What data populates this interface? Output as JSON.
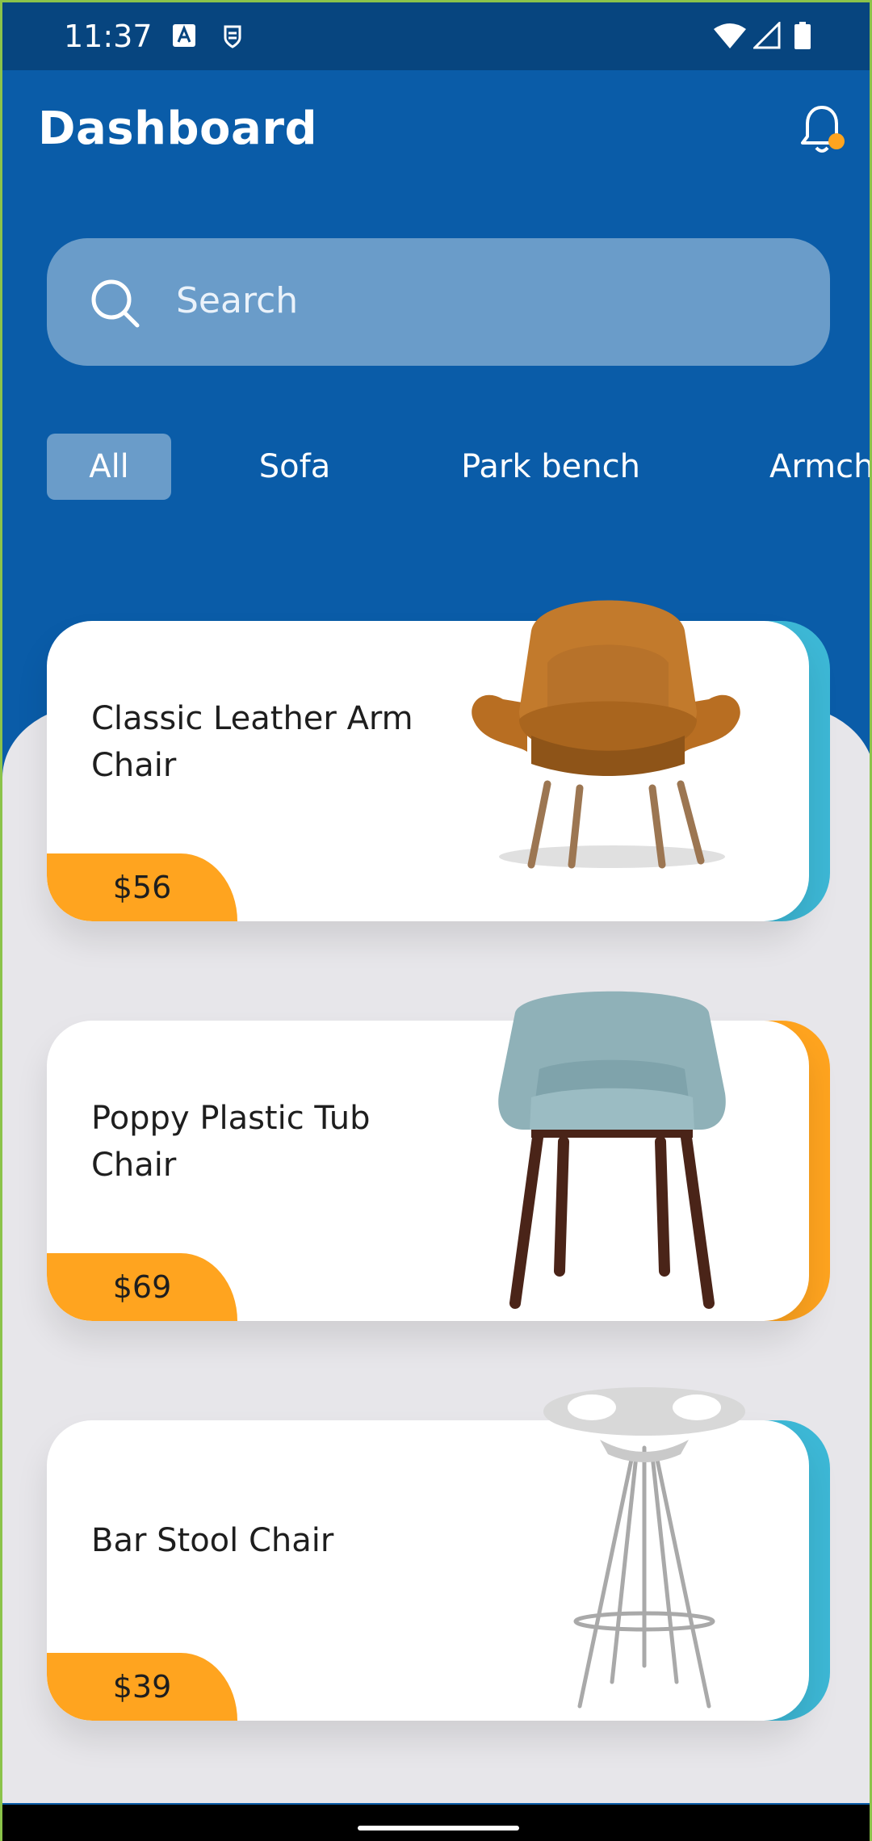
{
  "status_bar": {
    "time": "11:37",
    "icons": [
      "a-box-icon",
      "sync-shield-icon",
      "wifi-icon",
      "cellular-icon",
      "battery-icon"
    ]
  },
  "header": {
    "title": "Dashboard",
    "notification_icon": "bell-icon",
    "notification_dot_color": "#FFA41F"
  },
  "search": {
    "placeholder": "Search",
    "icon": "search-icon"
  },
  "categories": [
    {
      "label": "All",
      "active": true
    },
    {
      "label": "Sofa",
      "active": false
    },
    {
      "label": "Park bench",
      "active": false
    },
    {
      "label": "Armch",
      "active": false
    }
  ],
  "products": [
    {
      "name": "Classic Leather Arm Chair",
      "price": "$56",
      "accent_color": "#3DB8D6",
      "image": "armchair-image"
    },
    {
      "name": "Poppy Plastic Tub Chair",
      "price": "$69",
      "accent_color": "#FFA41F",
      "image": "tub-chair-image"
    },
    {
      "name": "Bar Stool Chair",
      "price": "$39",
      "accent_color": "#3DB8D6",
      "image": "bar-stool-image"
    }
  ],
  "colors": {
    "primary": "#0A5CA8",
    "status_bar": "#07457F",
    "chip_active": "#6A9CC9",
    "price_tab": "#FFA41F",
    "content_background": "#E7E6EA"
  }
}
